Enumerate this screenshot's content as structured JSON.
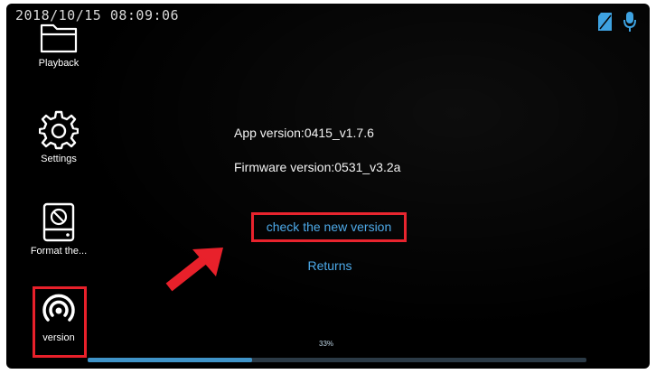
{
  "status_bar": {
    "datetime": "2018/10/15  08:09:06",
    "icons": [
      "sd-card-icon",
      "microphone-icon"
    ]
  },
  "sidebar": {
    "items": [
      {
        "label": "Playback",
        "icon": "folder-icon"
      },
      {
        "label": "Settings",
        "icon": "gear-icon"
      },
      {
        "label": "Format the...",
        "icon": "format-card-icon"
      },
      {
        "label": "version",
        "icon": "signal-icon"
      }
    ],
    "selected": "version"
  },
  "main": {
    "app_version": "App version:0415_v1.7.6",
    "firmware_version": "Firmware version:0531_v3.2a",
    "check_button": "check the new version",
    "returns_button": "Returns"
  },
  "progress": {
    "value": 0.33,
    "label": "33%"
  },
  "colors": {
    "highlight": "#e8202a",
    "accent": "#4aa8e8",
    "background": "#000000",
    "progress_fill": "#3f93c8"
  }
}
